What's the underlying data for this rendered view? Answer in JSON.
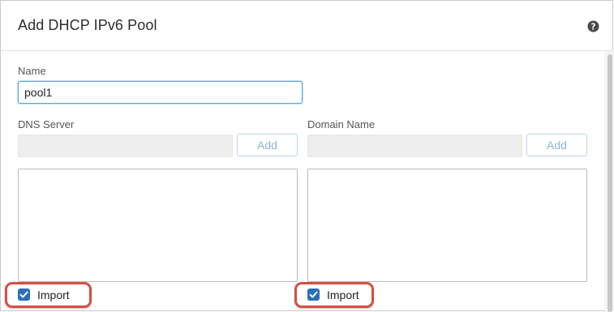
{
  "dialog": {
    "title": "Add DHCP IPv6 Pool"
  },
  "name_field": {
    "label": "Name",
    "value": "pool1"
  },
  "dns_server": {
    "label": "DNS Server",
    "add_label": "Add",
    "import_label": "Import",
    "import_checked": true
  },
  "domain_name": {
    "label": "Domain Name",
    "add_label": "Add",
    "import_label": "Import",
    "import_checked": true
  },
  "colors": {
    "accent": "#2a6ebd",
    "highlight": "#d64f40",
    "focus_border": "#5aa8e0"
  }
}
